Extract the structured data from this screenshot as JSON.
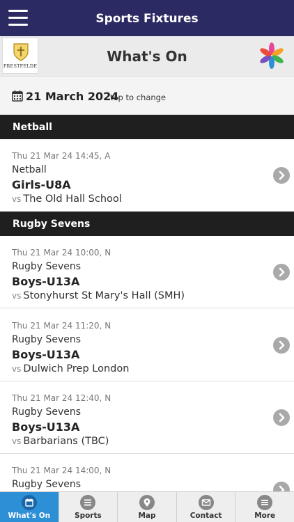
{
  "header": {
    "title": "Sports Fixtures"
  },
  "subheader": {
    "logo_text": "PRESTFELDE",
    "page_title": "What's On"
  },
  "date_bar": {
    "date": "21 March 2024",
    "hint": "tap to change"
  },
  "sections": [
    {
      "label": "Netball"
    },
    {
      "label": "Rugby Sevens"
    }
  ],
  "fixtures": [
    {
      "when": "Thu 21 Mar 24 14:45, A",
      "sport": "Netball",
      "team": "Girls-U8A",
      "vs": "vs",
      "opponent": "The Old Hall School"
    },
    {
      "when": "Thu 21 Mar 24 10:00, N",
      "sport": "Rugby Sevens",
      "team": "Boys-U13A",
      "vs": "vs",
      "opponent": "Stonyhurst St Mary's Hall (SMH)"
    },
    {
      "when": "Thu 21 Mar 24 11:20, N",
      "sport": "Rugby Sevens",
      "team": "Boys-U13A",
      "vs": "vs",
      "opponent": "Dulwich Prep London"
    },
    {
      "when": "Thu 21 Mar 24 12:40, N",
      "sport": "Rugby Sevens",
      "team": "Boys-U13A",
      "vs": "vs",
      "opponent": "Barbarians (TBC)"
    },
    {
      "when": "Thu 21 Mar 24 14:00, N",
      "sport": "Rugby Sevens",
      "team": "",
      "vs": "",
      "opponent": ""
    }
  ],
  "tabs": [
    {
      "label": "What's On",
      "icon": "calendar-icon",
      "active": true
    },
    {
      "label": "Sports",
      "icon": "list-icon",
      "active": false
    },
    {
      "label": "Map",
      "icon": "map-pin-icon",
      "active": false
    },
    {
      "label": "Contact",
      "icon": "envelope-icon",
      "active": false
    },
    {
      "label": "More",
      "icon": "menu-icon",
      "active": false
    }
  ],
  "colors": {
    "top_bar": "#2c2a63",
    "section_bar": "#1f1f1f",
    "active_tab": "#2d8fd6"
  }
}
